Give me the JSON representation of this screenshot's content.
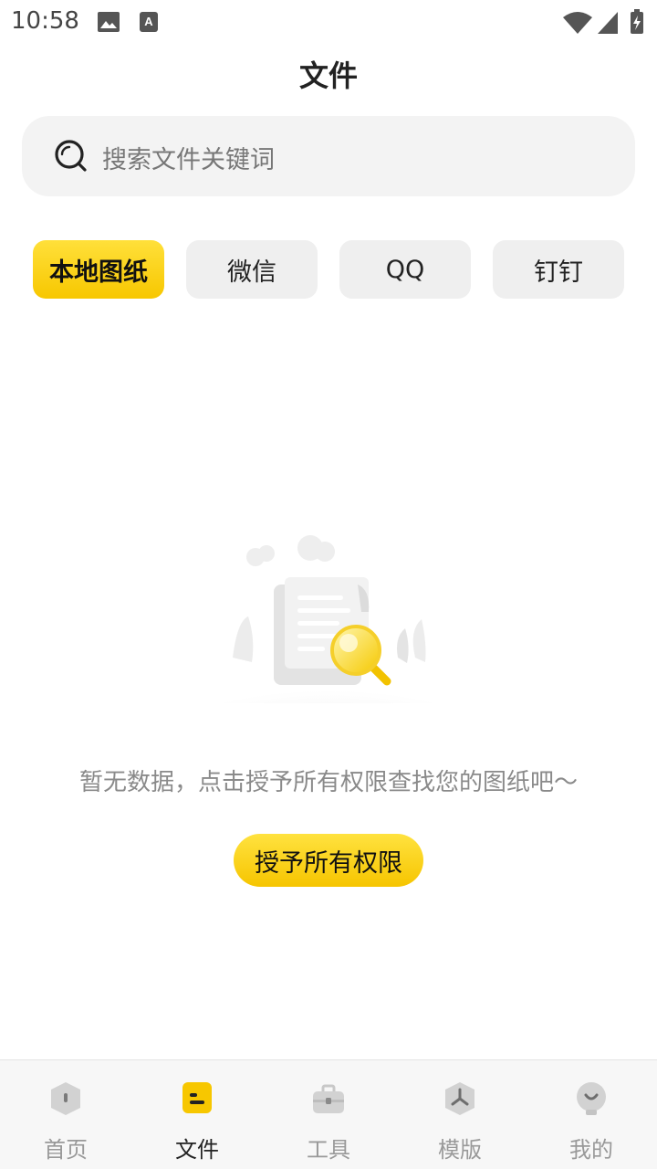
{
  "status_bar": {
    "time": "10:58",
    "icons": [
      "image-icon",
      "accessibility-a-icon",
      "wifi-icon",
      "signal-icon",
      "battery-charging-icon"
    ]
  },
  "header": {
    "title": "文件"
  },
  "search": {
    "placeholder": "搜索文件关键词"
  },
  "tabs": [
    {
      "label": "本地图纸",
      "active": true
    },
    {
      "label": "微信",
      "active": false
    },
    {
      "label": "QQ",
      "active": false
    },
    {
      "label": "钉钉",
      "active": false
    }
  ],
  "empty_state": {
    "illustration": "document-magnifier-illustration",
    "message": "暂无数据，点击授予所有权限查找您的图纸吧～",
    "button_label": "授予所有权限"
  },
  "bottom_nav": [
    {
      "label": "首页",
      "icon": "home-icon",
      "active": false
    },
    {
      "label": "文件",
      "icon": "file-icon",
      "active": true
    },
    {
      "label": "工具",
      "icon": "toolbox-icon",
      "active": false
    },
    {
      "label": "模版",
      "icon": "template-icon",
      "active": false
    },
    {
      "label": "我的",
      "icon": "profile-icon",
      "active": false
    }
  ],
  "colors": {
    "accent": "#f7c700",
    "tab_inactive": "#efefef",
    "nav_inactive": "#999999"
  }
}
